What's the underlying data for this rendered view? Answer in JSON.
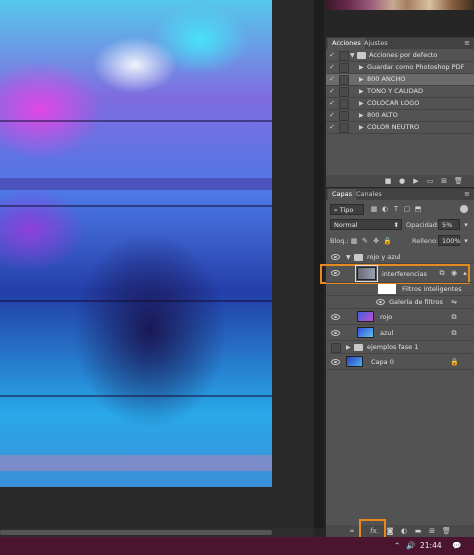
{
  "actions_panel": {
    "tabs": [
      "Acciones",
      "Ajustes"
    ],
    "rows": [
      {
        "label": "Acciones por defecto",
        "checked": true,
        "kind": "folder"
      },
      {
        "label": "Guardar como Photoshop PDF",
        "checked": true,
        "kind": "action"
      },
      {
        "label": "800 ANCHO",
        "checked": true,
        "kind": "action",
        "selected": true
      },
      {
        "label": "TONO Y CALIDAD",
        "checked": true,
        "kind": "action"
      },
      {
        "label": "COLOCAR LOGO",
        "checked": true,
        "kind": "action"
      },
      {
        "label": "800 ALTO",
        "checked": true,
        "kind": "action"
      },
      {
        "label": "COLOR NEUTRO",
        "checked": true,
        "kind": "action"
      }
    ],
    "footer_icons": [
      "stop-icon",
      "record-icon",
      "play-icon",
      "new-set-icon",
      "new-action-icon",
      "delete-icon"
    ]
  },
  "layers_panel": {
    "tabs": [
      "Capas",
      "Canales"
    ],
    "filter": "Tipo",
    "blend_mode": "Normal",
    "opacity_label": "Opacidad:",
    "opacity_value": "5%",
    "lock_label": "Bloq.:",
    "fill_label": "Relleno:",
    "fill_value": "100%",
    "layers": [
      {
        "name": "rojo y azul",
        "type": "group",
        "visible": true
      },
      {
        "name": "interferencias",
        "type": "smart",
        "visible": true,
        "highlighted": true
      },
      {
        "name": "Filtros inteligentes",
        "type": "smart-filters"
      },
      {
        "name": "Galería de filtros",
        "type": "filter"
      },
      {
        "name": "rojo",
        "type": "pixel",
        "visible": true
      },
      {
        "name": "azul",
        "type": "pixel",
        "visible": true
      },
      {
        "name": "ejemplos fase 1",
        "type": "group",
        "visible": false
      },
      {
        "name": "Capa 0",
        "type": "pixel",
        "visible": true,
        "locked": true
      }
    ],
    "footer": {
      "fx_label": "fx."
    }
  },
  "taskbar": {
    "time": "21:44",
    "volume_icon": "volume-icon",
    "chevron_icon": "chevron-up-icon",
    "notification_icon": "notification-icon"
  },
  "colors": {
    "highlight": "#e58a20",
    "panel_bg": "#535353",
    "taskbar_bg": "#4b1530"
  }
}
